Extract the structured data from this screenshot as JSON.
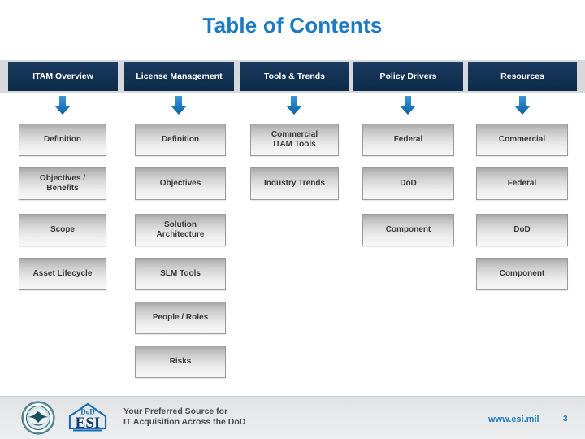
{
  "slide": {
    "title": "Table of Contents",
    "title_color": "#1b7ac2"
  },
  "header": {
    "band_color": "#d6d8dc",
    "box_color": "#143254",
    "columns": [
      {
        "label": "ITAM Overview"
      },
      {
        "label": "License Management"
      },
      {
        "label": "Tools & Trends"
      },
      {
        "label": "Policy Drivers"
      },
      {
        "label": "Resources"
      }
    ]
  },
  "arrows": {
    "icon": "arrow-down-icon",
    "color": "#1b7ac2",
    "count": 5
  },
  "columns": [
    {
      "heading": "ITAM Overview",
      "items": [
        "Definition",
        "Objectives /\nBenefits",
        "Scope",
        "Asset Lifecycle"
      ],
      "item_labels": [
        {
          "line1": "Definition",
          "line2": ""
        },
        {
          "line1": "Objectives /",
          "line2": "Benefits"
        },
        {
          "line1": "Scope",
          "line2": ""
        },
        {
          "line1": "Asset Lifecycle",
          "line2": ""
        }
      ]
    },
    {
      "heading": "License Management",
      "item_labels": [
        {
          "line1": "Definition",
          "line2": ""
        },
        {
          "line1": "Objectives",
          "line2": ""
        },
        {
          "line1": "Solution",
          "line2": "Architecture"
        },
        {
          "line1": "SLM Tools",
          "line2": ""
        },
        {
          "line1": "People / Roles",
          "line2": ""
        },
        {
          "line1": "Risks",
          "line2": ""
        }
      ]
    },
    {
      "heading": "Tools & Trends",
      "item_labels": [
        {
          "line1": "Commercial",
          "line2": "ITAM Tools"
        },
        {
          "line1": "Industry Trends",
          "line2": ""
        }
      ]
    },
    {
      "heading": "Policy Drivers",
      "item_labels": [
        {
          "line1": "Federal",
          "line2": ""
        },
        {
          "line1": "DoD",
          "line2": ""
        },
        {
          "line1": "Component",
          "line2": ""
        }
      ]
    },
    {
      "heading": "Resources",
      "item_labels": [
        {
          "line1": "Commercial",
          "line2": ""
        },
        {
          "line1": "Federal",
          "line2": ""
        },
        {
          "line1": "DoD",
          "line2": ""
        },
        {
          "line1": "Component",
          "line2": ""
        }
      ]
    }
  ],
  "footer": {
    "dod_seal_icon": "dod-seal-icon",
    "esi_logo_icon": "dod-esi-logo-icon",
    "esi_logo_text_top": "DoD",
    "esi_logo_text_main": "ESI",
    "tagline_line1": "Your Preferred Source for",
    "tagline_line2": "IT Acquisition Across the DoD",
    "url": "www.esi.mil",
    "page_number": "3",
    "accent_color": "#1b7ac2"
  }
}
